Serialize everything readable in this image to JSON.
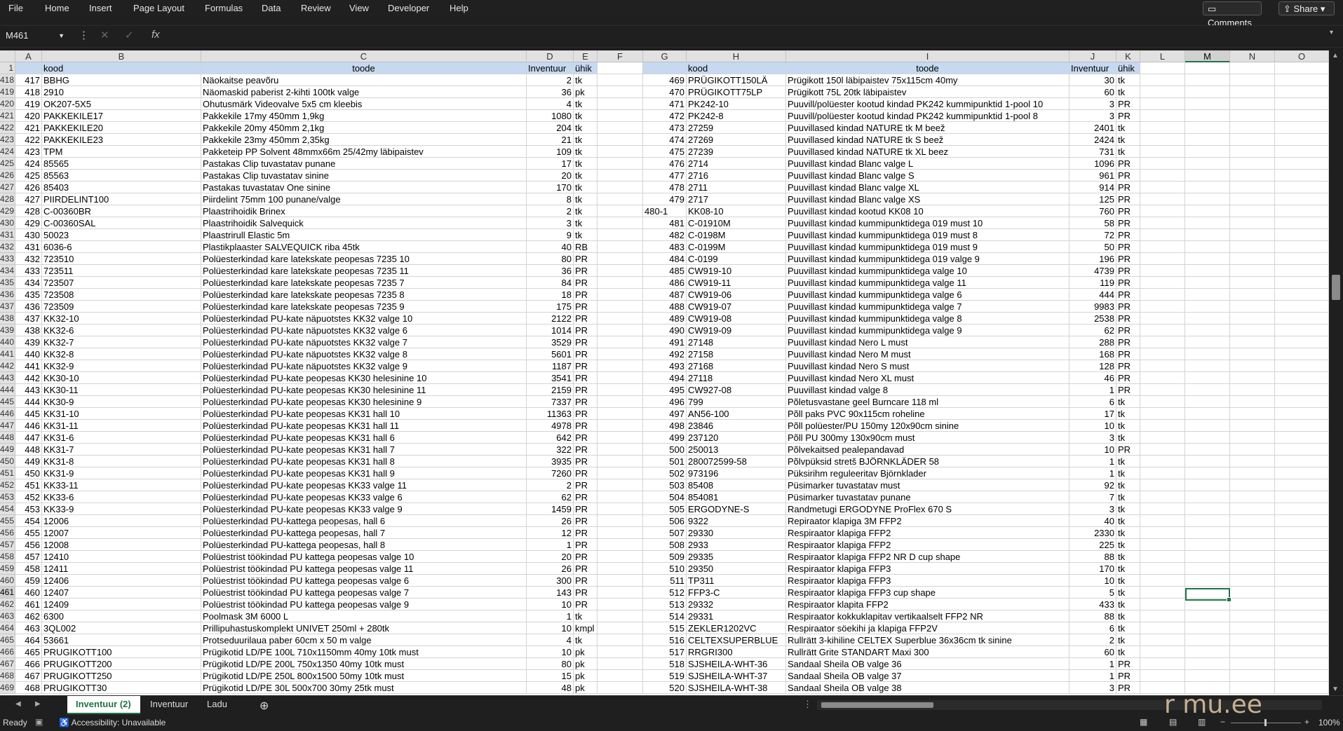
{
  "menu": [
    "File",
    "Home",
    "Insert",
    "Page Layout",
    "Formulas",
    "Data",
    "Review",
    "View",
    "Developer",
    "Help"
  ],
  "top_buttons": {
    "comments": "Comments",
    "share": "Share"
  },
  "namebox": "M461",
  "columns_left": [
    "A",
    "B",
    "C",
    "D",
    "E",
    "F"
  ],
  "columns_right": [
    "G",
    "H",
    "I",
    "J",
    "K",
    "L",
    "M",
    "N",
    "O"
  ],
  "header_row": {
    "num": "1",
    "kood": "kood",
    "toode": "toode",
    "inventuur": "Inventuur",
    "uhik": "ühik"
  },
  "row_numbers": [
    "418",
    "419",
    "420",
    "421",
    "422",
    "423",
    "424",
    "425",
    "426",
    "427",
    "428",
    "429",
    "430",
    "431",
    "432",
    "433",
    "434",
    "435",
    "436",
    "437",
    "438",
    "439",
    "440",
    "441",
    "442",
    "443",
    "444",
    "445",
    "446",
    "447",
    "448",
    "449",
    "450",
    "451",
    "452",
    "453",
    "454",
    "455",
    "456",
    "457",
    "458",
    "459",
    "460",
    "461",
    "462",
    "463",
    "464",
    "465",
    "466",
    "467",
    "468",
    "469"
  ],
  "left_rows": [
    [
      "417",
      "BBHG",
      "Näokaitse peavõru",
      "2",
      "tk"
    ],
    [
      "418",
      "2910",
      "Näomaskid paberist 2-kihti 100tk valge",
      "36",
      "pk"
    ],
    [
      "419",
      "OK207-5X5",
      "Ohutusmärk Videovalve 5x5 cm kleebis",
      "4",
      "tk"
    ],
    [
      "420",
      "PAKKEKILE17",
      "Pakkekile 17my 450mm 1,9kg",
      "1080",
      "tk"
    ],
    [
      "421",
      "PAKKEKILE20",
      "Pakkekile 20my 450mm 2,1kg",
      "204",
      "tk"
    ],
    [
      "422",
      "PAKKEKILE23",
      "Pakkekile 23my 450mm 2,35kg",
      "21",
      "tk"
    ],
    [
      "423",
      "TPM",
      "Pakketeip PP Solvent 48mmx66m 25/42my läbipaistev",
      "109",
      "tk"
    ],
    [
      "424",
      "85565",
      "Pastakas Clip tuvastatav punane",
      "17",
      "tk"
    ],
    [
      "425",
      "85563",
      "Pastakas Clip tuvastatav sinine",
      "20",
      "tk"
    ],
    [
      "426",
      "85403",
      "Pastakas tuvastatav One sinine",
      "170",
      "tk"
    ],
    [
      "427",
      "PIIRDELINT100",
      "Piirdelint 75mm 100 punane/valge",
      "8",
      "tk"
    ],
    [
      "428",
      "C-00360BR",
      "Plaastrihoidik Brinex",
      "2",
      "tk"
    ],
    [
      "429",
      "C-00360SAL",
      "Plaastrihoidik Salvequick",
      "3",
      "tk"
    ],
    [
      "430",
      "50023",
      "Plaastrirull Elastic 5m",
      "9",
      "tk"
    ],
    [
      "431",
      "6036-6",
      "Plastikplaaster SALVEQUICK riba 45tk",
      "40",
      "RB"
    ],
    [
      "432",
      "723510",
      "Polüesterkindad kare latekskate peopesas 7235 10",
      "80",
      "PR"
    ],
    [
      "433",
      "723511",
      "Polüesterkindad kare latekskate peopesas 7235 11",
      "36",
      "PR"
    ],
    [
      "434",
      "723507",
      "Polüesterkindad kare latekskate peopesas 7235 7",
      "84",
      "PR"
    ],
    [
      "435",
      "723508",
      "Polüesterkindad kare latekskate peopesas 7235 8",
      "18",
      "PR"
    ],
    [
      "436",
      "723509",
      "Polüesterkindad kare latekskate peopesas 7235 9",
      "175",
      "PR"
    ],
    [
      "437",
      "KK32-10",
      "Polüesterkindad PU-kate näpuotstes KK32 valge 10",
      "2122",
      "PR"
    ],
    [
      "438",
      "KK32-6",
      "Polüesterkindad PU-kate näpuotstes KK32 valge 6",
      "1014",
      "PR"
    ],
    [
      "439",
      "KK32-7",
      "Polüesterkindad PU-kate näpuotstes KK32 valge 7",
      "3529",
      "PR"
    ],
    [
      "440",
      "KK32-8",
      "Polüesterkindad PU-kate näpuotstes KK32 valge 8",
      "5601",
      "PR"
    ],
    [
      "441",
      "KK32-9",
      "Polüesterkindad PU-kate näpuotstes KK32 valge 9",
      "1187",
      "PR"
    ],
    [
      "442",
      "KK30-10",
      "Polüesterkindad PU-kate peopesas KK30 helesinine 10",
      "3541",
      "PR"
    ],
    [
      "443",
      "KK30-11",
      "Polüesterkindad PU-kate peopesas KK30 helesinine 11",
      "2159",
      "PR"
    ],
    [
      "444",
      "KK30-9",
      "Polüesterkindad PU-kate peopesas KK30 helesinine 9",
      "7337",
      "PR"
    ],
    [
      "445",
      "KK31-10",
      "Polüesterkindad PU-kate peopesas KK31 hall 10",
      "11363",
      "PR"
    ],
    [
      "446",
      "KK31-11",
      "Polüesterkindad PU-kate peopesas KK31 hall 11",
      "4978",
      "PR"
    ],
    [
      "447",
      "KK31-6",
      "Polüesterkindad PU-kate peopesas KK31 hall 6",
      "642",
      "PR"
    ],
    [
      "448",
      "KK31-7",
      "Polüesterkindad PU-kate peopesas KK31 hall 7",
      "322",
      "PR"
    ],
    [
      "449",
      "KK31-8",
      "Polüesterkindad PU-kate peopesas KK31 hall 8",
      "3935",
      "PR"
    ],
    [
      "450",
      "KK31-9",
      "Polüesterkindad PU-kate peopesas KK31 hall 9",
      "7260",
      "PR"
    ],
    [
      "451",
      "KK33-11",
      "Polüesterkindad PU-kate peopesas KK33 valge 11",
      "2",
      "PR"
    ],
    [
      "452",
      "KK33-6",
      "Polüesterkindad PU-kate peopesas KK33 valge 6",
      "62",
      "PR"
    ],
    [
      "453",
      "KK33-9",
      "Polüesterkindad PU-kate peopesas KK33 valge 9",
      "1459",
      "PR"
    ],
    [
      "454",
      "12006",
      "Polüesterkindad PU-kattega peopesas, hall 6",
      "26",
      "PR"
    ],
    [
      "455",
      "12007",
      "Polüesterkindad PU-kattega peopesas, hall 7",
      "12",
      "PR"
    ],
    [
      "456",
      "12008",
      "Polüesterkindad PU-kattega peopesas, hall 8",
      "1",
      "PR"
    ],
    [
      "457",
      "12410",
      "Polüestrist töökindad PU kattega peopesas valge 10",
      "20",
      "PR"
    ],
    [
      "458",
      "12411",
      "Polüestrist töökindad PU kattega peopesas valge 11",
      "26",
      "PR"
    ],
    [
      "459",
      "12406",
      "Polüestrist töökindad PU kattega peopesas valge 6",
      "300",
      "PR"
    ],
    [
      "460",
      "12407",
      "Polüestrist töökindad PU kattega peopesas valge 7",
      "143",
      "PR"
    ],
    [
      "461",
      "12409",
      "Polüestrist töökindad PU kattega peopesas valge 9",
      "10",
      "PR"
    ],
    [
      "462",
      "6300",
      "Poolmask 3M 6000 L",
      "1",
      "tk"
    ],
    [
      "463",
      "3QL002",
      "Prillipuhastuskomplekt UNIVET 250ml + 280tk",
      "10",
      "kmpl"
    ],
    [
      "464",
      "53661",
      "Protseduurilaua paber 60cm x 50 m valge",
      "4",
      "tk"
    ],
    [
      "465",
      "PRUGIKOTT100",
      "Prügikotid LD/PE 100L 710x1150mm 40my 10tk must",
      "10",
      "pk"
    ],
    [
      "466",
      "PRUGIKOTT200",
      "Prügikotid LD/PE 200L 750x1350 40my 10tk must",
      "80",
      "pk"
    ],
    [
      "467",
      "PRUGIKOTT250",
      "Prügikotid LD/PE 250L 800x1500 50my 10tk must",
      "15",
      "pk"
    ],
    [
      "468",
      "PRUGIKOTT30",
      "Prügikotid LD/PE 30L 500x700 30my 25tk must",
      "48",
      "pk"
    ]
  ],
  "right_rows": [
    [
      "469",
      "PRÜGIKOTT150LÄ",
      "Prügikott 150l läbipaistev 75x115cm 40my",
      "30",
      "tk"
    ],
    [
      "470",
      "PRÜGIKOTT75LP",
      "Prügikott 75L 20tk läbipaistev",
      "60",
      "tk"
    ],
    [
      "471",
      "PK242-10",
      "Puuvill/polüester kootud kindad PK242 kummipunktid 1-pool 10",
      "3",
      "PR"
    ],
    [
      "472",
      "PK242-8",
      "Puuvill/polüester kootud kindad PK242 kummipunktid 1-pool 8",
      "3",
      "PR"
    ],
    [
      "473",
      "27259",
      "Puuvillased kindad NATURE tk M beež",
      "2401",
      "tk"
    ],
    [
      "474",
      "27269",
      "Puuvillased kindad NATURE tk S beež",
      "2424",
      "tk"
    ],
    [
      "475",
      "27239",
      "Puuvillased kindad NATURE tk XL beez",
      "731",
      "tk"
    ],
    [
      "476",
      "2714",
      "Puuvillast kindad Blanc valge L",
      "1096",
      "PR"
    ],
    [
      "477",
      "2716",
      "Puuvillast kindad Blanc valge S",
      "961",
      "PR"
    ],
    [
      "478",
      "2711",
      "Puuvillast kindad Blanc valge XL",
      "914",
      "PR"
    ],
    [
      "479",
      "2717",
      "Puuvillast kindad Blanc valge XS",
      "125",
      "PR"
    ],
    [
      "480-1",
      "KK08-10",
      "Puuvillast kindad kootud KK08 10",
      "760",
      "PR"
    ],
    [
      "481",
      "C-01910M",
      "Puuvillast kindad kummipunktidega 019 must 10",
      "58",
      "PR"
    ],
    [
      "482",
      "C-0198M",
      "Puuvillast kindad kummipunktidega 019 must 8",
      "72",
      "PR"
    ],
    [
      "483",
      "C-0199M",
      "Puuvillast kindad kummipunktidega 019 must 9",
      "50",
      "PR"
    ],
    [
      "484",
      "C-0199",
      "Puuvillast kindad kummipunktidega 019 valge 9",
      "196",
      "PR"
    ],
    [
      "485",
      "CW919-10",
      "Puuvillast kindad kummipunktidega valge 10",
      "4739",
      "PR"
    ],
    [
      "486",
      "CW919-11",
      "Puuvillast kindad kummipunktidega valge 11",
      "119",
      "PR"
    ],
    [
      "487",
      "CW919-06",
      "Puuvillast kindad kummipunktidega valge 6",
      "444",
      "PR"
    ],
    [
      "488",
      "CW919-07",
      "Puuvillast kindad kummipunktidega valge 7",
      "9983",
      "PR"
    ],
    [
      "489",
      "CW919-08",
      "Puuvillast kindad kummipunktidega valge 8",
      "2538",
      "PR"
    ],
    [
      "490",
      "CW919-09",
      "Puuvillast kindad kummipunktidega valge 9",
      "62",
      "PR"
    ],
    [
      "491",
      "27148",
      "Puuvillast kindad Nero L must",
      "288",
      "PR"
    ],
    [
      "492",
      "27158",
      "Puuvillast kindad Nero M must",
      "168",
      "PR"
    ],
    [
      "493",
      "27168",
      "Puuvillast kindad Nero S must",
      "128",
      "PR"
    ],
    [
      "494",
      "27118",
      "Puuvillast kindad Nero XL must",
      "46",
      "PR"
    ],
    [
      "495",
      "CW927-08",
      "Puuvillast kindad valge 8",
      "1",
      "PR"
    ],
    [
      "496",
      "799",
      "Põletusvastane geel Burncare 118 ml",
      "6",
      "tk"
    ],
    [
      "497",
      "AN56-100",
      "Põll paks PVC 90x115cm roheline",
      "17",
      "tk"
    ],
    [
      "498",
      "23846",
      "Põll polüester/PU 150my 120x90cm sinine",
      "10",
      "tk"
    ],
    [
      "499",
      "237120",
      "Põll PU 300my 130x90cm must",
      "3",
      "tk"
    ],
    [
      "500",
      "250013",
      "Põlvekaitsed pealepandavad",
      "10",
      "PR"
    ],
    [
      "501",
      "280072599-58",
      "Põlvpüksid stretš BJÖRNKLÄDER 58",
      "1",
      "tk"
    ],
    [
      "502",
      "973196",
      "Püksirihm reguleeritav Björnklader",
      "1",
      "tk"
    ],
    [
      "503",
      "85408",
      "Püsimarker tuvastatav must",
      "92",
      "tk"
    ],
    [
      "504",
      "854081",
      "Püsimarker tuvastatav punane",
      "7",
      "tk"
    ],
    [
      "505",
      "ERGODYNE-S",
      "Randmetugi ERGODYNE ProFlex 670 S",
      "3",
      "tk"
    ],
    [
      "506",
      "9322",
      "Repiraator klapiga 3M FFP2",
      "40",
      "tk"
    ],
    [
      "507",
      "29330",
      "Respiraator klapiga FFP2",
      "2330",
      "tk"
    ],
    [
      "508",
      "2933",
      "Respiraator klapiga FFP2",
      "225",
      "tk"
    ],
    [
      "509",
      "29335",
      "Respiraator klapiga FFP2 NR D cup shape",
      "88",
      "tk"
    ],
    [
      "510",
      "29350",
      "Respiraator klapiga FFP3",
      "170",
      "tk"
    ],
    [
      "511",
      "TP311",
      "Respiraator klapiga FFP3",
      "10",
      "tk"
    ],
    [
      "512",
      "FFP3-C",
      "Respiraator klapiga FFP3 cup shape",
      "5",
      "tk"
    ],
    [
      "513",
      "29332",
      "Respiraator klapita FFP2",
      "433",
      "tk"
    ],
    [
      "514",
      "29331",
      "Respiraator kokkuklapitav vertikaalselt FFP2 NR",
      "88",
      "tk"
    ],
    [
      "515",
      "ZEKLER1202VC",
      "Respiraator söekihi ja klapiga FFP2V",
      "6",
      "tk"
    ],
    [
      "516",
      "CELTEXSUPERBLUE",
      "Rullrätt 3-kihiline CELTEX Superblue 36x36cm tk sinine",
      "2",
      "tk"
    ],
    [
      "517",
      "RRGRI300",
      "Rullrätt Grite STANDART Maxi 300",
      "60",
      "tk"
    ],
    [
      "518",
      "SJSHEILA-WHT-36",
      "Sandaal Sheila OB valge 36",
      "1",
      "PR"
    ],
    [
      "519",
      "SJSHEILA-WHT-37",
      "Sandaal Sheila OB valge 37",
      "1",
      "PR"
    ],
    [
      "520",
      "SJSHEILA-WHT-38",
      "Sandaal Sheila OB valge 38",
      "3",
      "PR"
    ]
  ],
  "tabs": [
    "Inventuur (2)",
    "Inventuur",
    "Ladu"
  ],
  "status": {
    "ready": "Ready",
    "accessibility": "Accessibility: Unavailable",
    "zoom": "100%"
  },
  "watermark": "r  mu.ee"
}
